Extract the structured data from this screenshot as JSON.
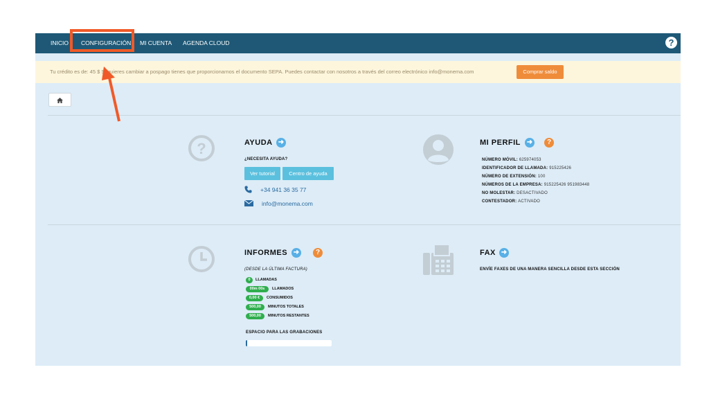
{
  "nav": {
    "items": [
      "INICIO",
      "CONFIGURACIÓN",
      "MI CUENTA",
      "AGENDA CLOUD"
    ],
    "help_glyph": "?"
  },
  "notice": {
    "text": "Tu crédito es de: 45 $ Si quieres cambiar a pospago tienes que proporcionarnos el documento SEPA. Puedes contactar con nosotros a través del correo electrónico info@monema.com",
    "button": "Comprar saldo"
  },
  "home_icon": "home-icon",
  "ayuda": {
    "title": "AYUDA",
    "question": "¿NECESITA AYUDA?",
    "btn_tutorial": "Ver tutorial",
    "btn_centro": "Centro de ayuda",
    "phone": "+34 941 36 35 77",
    "email": "info@monema.com"
  },
  "perfil": {
    "title": "MI PERFIL",
    "rows": [
      {
        "label": "NÚMERO MÓVIL:",
        "value": "625974053"
      },
      {
        "label": "IDENTIFICADOR DE LLAMADA:",
        "value": "915225426"
      },
      {
        "label": "NÚMERO DE EXTENSIÓN:",
        "value": "100"
      },
      {
        "label": "NÚMEROS DE LA EMPRESA:",
        "value": "915225426 951983448"
      },
      {
        "label": "NO MOLESTAR:",
        "value": "DESACTIVADO"
      },
      {
        "label": "CONTESTADOR:",
        "value": "ACTIVADO"
      }
    ]
  },
  "informes": {
    "title": "INFORMES",
    "subtitle": "(DESDE LA ÚLTIMA FACTURA)",
    "stats": [
      {
        "badge": "0",
        "label": "LLAMADAS"
      },
      {
        "badge": "00m 00s",
        "label": "LLAMADOS"
      },
      {
        "badge": "0,00 €",
        "label": "CONSUMIDOS"
      },
      {
        "badge": "500,00",
        "label": "MINUTOS TOTALES"
      },
      {
        "badge": "500,00",
        "label": "MINUTOS RESTANTES"
      }
    ],
    "storage_label": "ESPACIO PARA LAS GRABACIONES",
    "storage_used": 0.02
  },
  "fax": {
    "title": "FAX",
    "description": "ENVÍE FAXES DE UNA MANERA SENCILLA DESDE ESTA SECCIÓN"
  },
  "colors": {
    "nav_bg": "#1e5876",
    "highlight": "#f05a28",
    "accent_blue": "#58b0e6",
    "accent_orange": "#ef8c3a",
    "badge_green": "#2fae4e"
  }
}
